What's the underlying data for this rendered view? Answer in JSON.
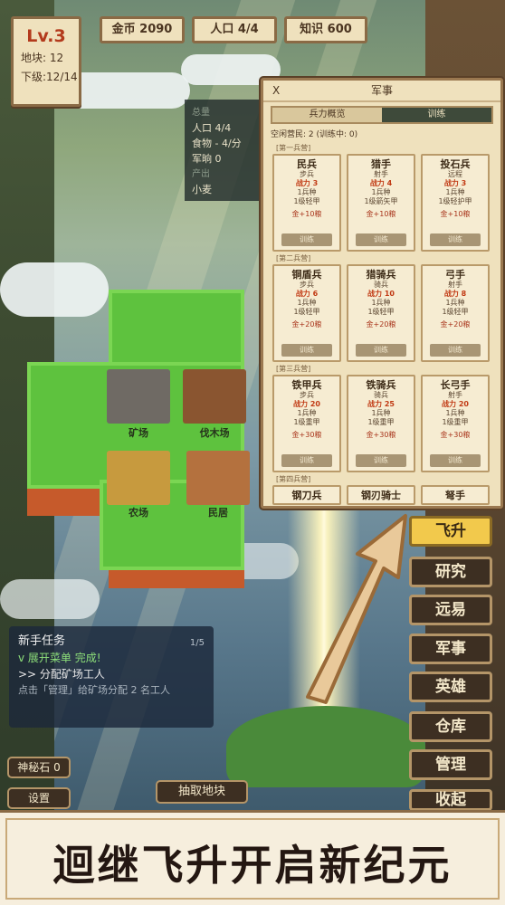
{
  "level": {
    "title": "Lv.3",
    "plots": "地块: 12",
    "next": "下级:12/14"
  },
  "resources": {
    "gold": "金币 2090",
    "population": "人口 4/4",
    "knowledge": "知识 600"
  },
  "stats_panel": {
    "header": "总量",
    "population": "人口 4/4",
    "food": "食物 - 4/分",
    "military_pay": "军晌 0",
    "output_label": "产出",
    "output_value": "小麦"
  },
  "buildings": [
    {
      "label": "矿场"
    },
    {
      "label": "伐木场"
    },
    {
      "label": "农场"
    },
    {
      "label": "民居"
    }
  ],
  "military_panel": {
    "close": "X",
    "title": "军事",
    "tabs": [
      {
        "label": "兵力概览"
      },
      {
        "label": "训练"
      }
    ],
    "queue": "空闲营民: 2 (训练中: 0)",
    "groups": [
      {
        "title": "[第一兵营]",
        "units": [
          {
            "name": "民兵",
            "type": "步兵",
            "power": "战力 3",
            "line1": "1兵种",
            "line2": "1级轻甲",
            "cost": "金+10粮",
            "btn": "训练"
          },
          {
            "name": "猎手",
            "type": "射手",
            "power": "战力 4",
            "line1": "1兵种",
            "line2": "1级箭矢甲",
            "cost": "金+10粮",
            "btn": "训练"
          },
          {
            "name": "投石兵",
            "type": "远程",
            "power": "战力 3",
            "line1": "1兵种",
            "line2": "1级轻护甲",
            "cost": "金+10粮",
            "btn": "训练"
          }
        ]
      },
      {
        "title": "[第二兵营]",
        "units": [
          {
            "name": "铜盾兵",
            "type": "步兵",
            "power": "战力 6",
            "line1": "1兵种",
            "line2": "1级轻甲",
            "cost": "金+20粮",
            "btn": "训练"
          },
          {
            "name": "猎骑兵",
            "type": "骑兵",
            "power": "战力 10",
            "line1": "1兵种",
            "line2": "1级轻甲",
            "cost": "金+20粮",
            "btn": "训练"
          },
          {
            "name": "弓手",
            "type": "射手",
            "power": "战力 8",
            "line1": "1兵种",
            "line2": "1级轻甲",
            "cost": "金+20粮",
            "btn": "训练"
          }
        ]
      },
      {
        "title": "[第三兵营]",
        "units": [
          {
            "name": "铁甲兵",
            "type": "步兵",
            "power": "战力 20",
            "line1": "1兵种",
            "line2": "1级重甲",
            "cost": "金+30粮",
            "btn": "训练"
          },
          {
            "name": "铁骑兵",
            "type": "骑兵",
            "power": "战力 25",
            "line1": "1兵种",
            "line2": "1级重甲",
            "cost": "金+30粮",
            "btn": "训练"
          },
          {
            "name": "长弓手",
            "type": "射手",
            "power": "战力 20",
            "line1": "1兵种",
            "line2": "1级重甲",
            "cost": "金+30粮",
            "btn": "训练"
          }
        ]
      },
      {
        "title": "[第四兵营]",
        "units": [
          {
            "name": "钢刀兵"
          },
          {
            "name": "钢刃骑士"
          },
          {
            "name": "弩手"
          }
        ]
      }
    ]
  },
  "side_buttons": [
    {
      "label": "飞升"
    },
    {
      "label": "研究"
    },
    {
      "label": "远易"
    },
    {
      "label": "军事"
    },
    {
      "label": "英雄"
    },
    {
      "label": "仓库"
    },
    {
      "label": "管理"
    },
    {
      "label": "收起"
    }
  ],
  "quest": {
    "title": "新手任务",
    "progress": "1/5",
    "done": "v 展开菜单 完成!",
    "current": ">> 分配矿场工人",
    "desc": "点击「管理」给矿场分配 2 名工人"
  },
  "bottom_left": {
    "stone": "神秘石 0",
    "settings": "设置"
  },
  "draw_button": "抽取地块",
  "banner": "迴继飞升开启新纪元",
  "colors": {
    "accent_gold": "#f2c94c",
    "panel_bg": "#efe1bd",
    "grass": "#5ec23e",
    "power_red": "#c13a14"
  }
}
